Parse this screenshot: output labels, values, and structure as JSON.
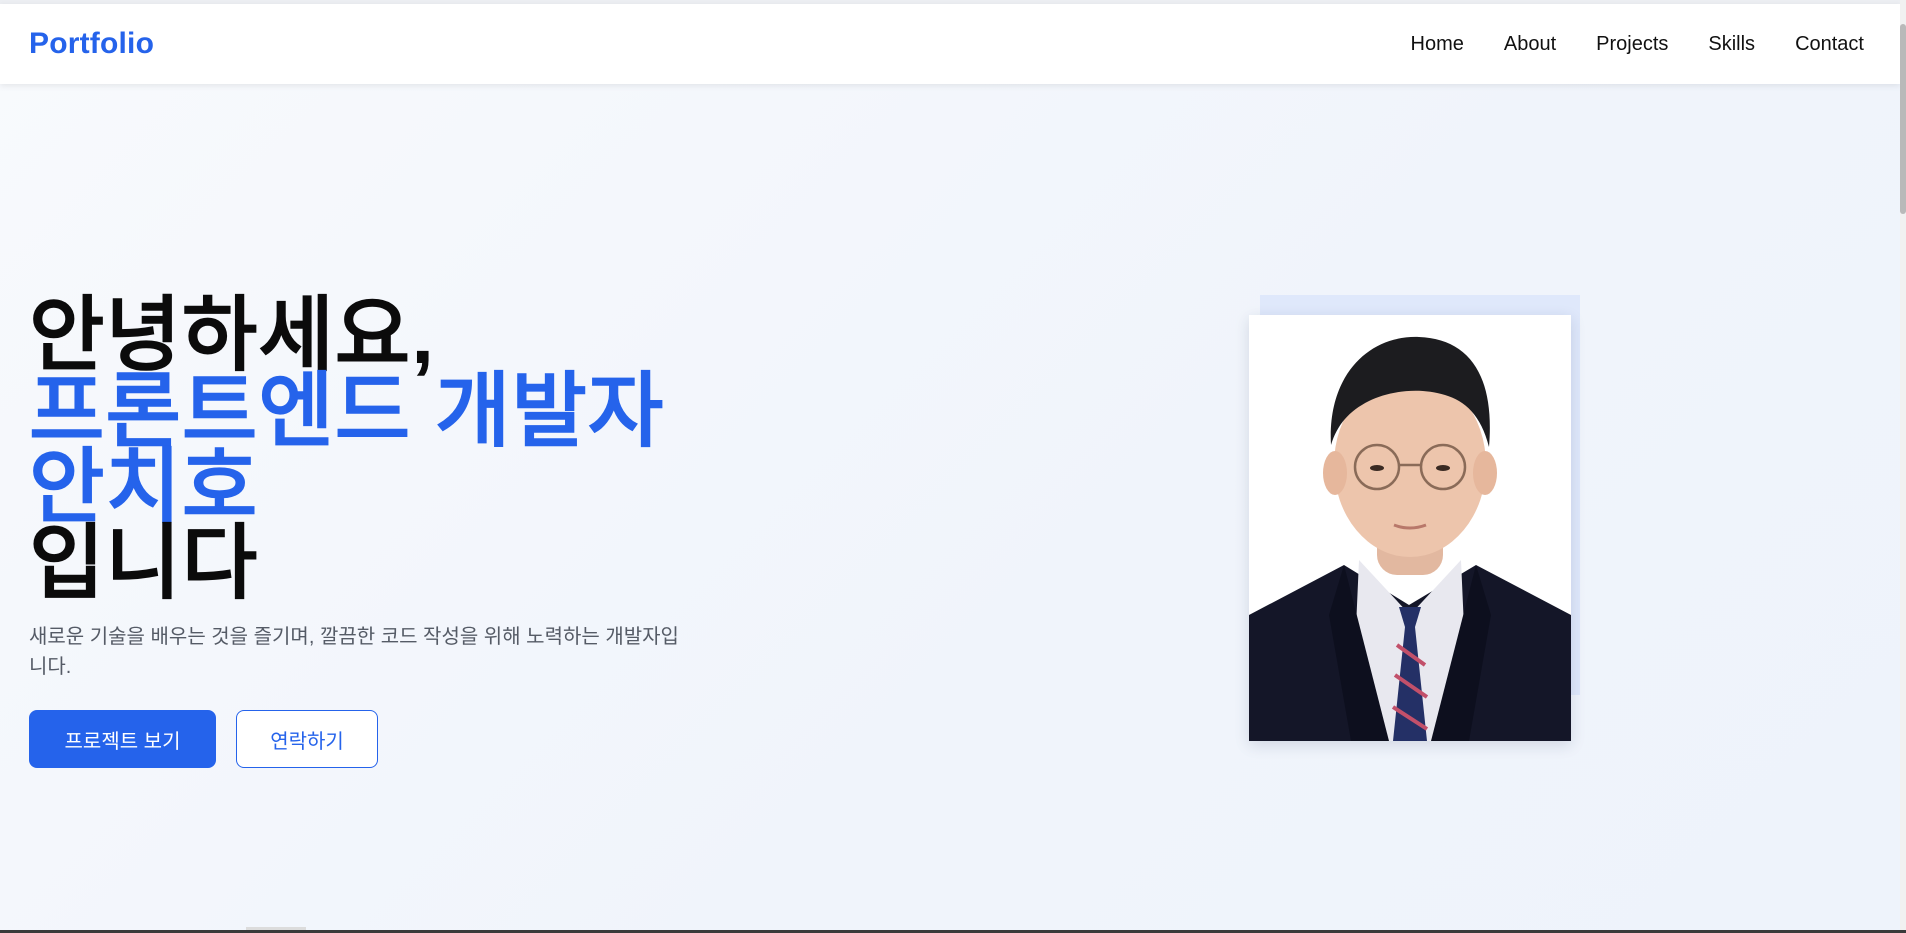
{
  "nav": {
    "logo": "Portfolio",
    "links": [
      "Home",
      "About",
      "Projects",
      "Skills",
      "Contact"
    ]
  },
  "hero": {
    "line1": "안녕하세요,",
    "line2": "프론트엔드 개발자",
    "line3": "안치호",
    "line4": "입니다",
    "description": "새로운 기술을 배우는 것을 즐기며, 깔끔한 코드 작성을 위해 노력하는 개발자입니다.",
    "primary_button": "프로젝트 보기",
    "secondary_button": "연락하기"
  },
  "colors": {
    "accent": "#2563eb",
    "text": "#0b0b0b",
    "muted": "#555b66"
  }
}
